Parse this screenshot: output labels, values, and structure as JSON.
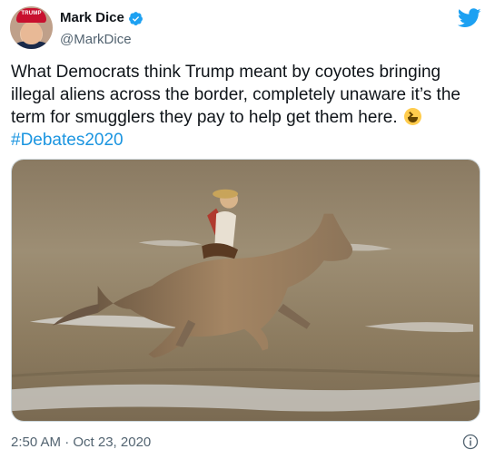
{
  "author": {
    "display_name": "Mark Dice",
    "handle": "@MarkDice",
    "hat_text": "TRUMP",
    "verified": true
  },
  "tweet": {
    "text": "What Democrats think Trump meant by coyotes bringing illegal aliens across the border, completely unaware it’s the term for smugglers they pay to help get them here.",
    "emoji": "grinning-squinting-face",
    "hashtag": "#Debates2020"
  },
  "media": {
    "description_icon": "photo"
  },
  "footer": {
    "timestamp": "2:50 AM · Oct 23, 2020"
  },
  "colors": {
    "link": "#1b95e0",
    "twitter_blue": "#1da1f2",
    "verified": "#1da1f2",
    "text": "#0f1419",
    "secondary": "#536471"
  }
}
